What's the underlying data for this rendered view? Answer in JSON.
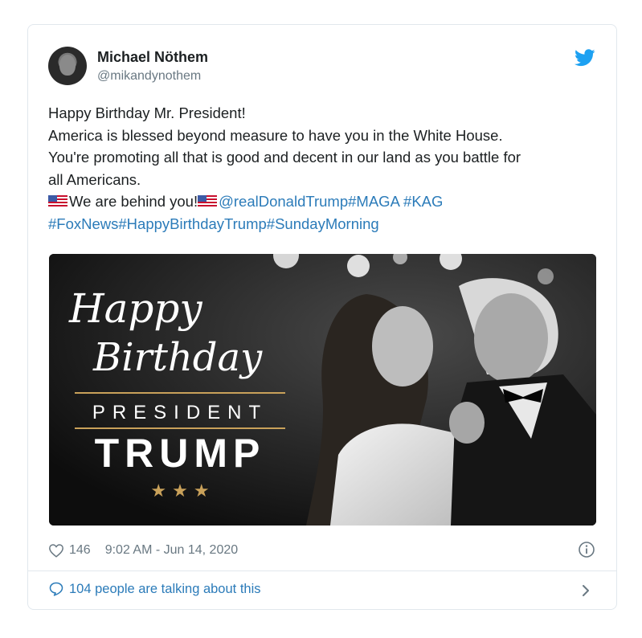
{
  "author": {
    "name": "Michael Nöthem",
    "handle": "@mikandynothem"
  },
  "tweet": {
    "line1": "Happy Birthday Mr. President!",
    "line2": "America is blessed beyond measure to have you in the White House.",
    "line3": "You're promoting all that is good and decent in our land as you battle for",
    "line4": "all Americans.",
    "line5_text": "We are behind you!",
    "mention": "@realDonaldTrump",
    "hashtag1": "#MAGA",
    "hashtag2": "#KAG",
    "hashtag3": "#FoxNews",
    "hashtag4": "#HappyBirthdayTrump",
    "hashtag5": "#SundayMorning"
  },
  "media": {
    "happy": "Happy",
    "birthday": "Birthday",
    "president": "PRESIDENT",
    "trump": "TRUMP",
    "stars": "★ ★ ★"
  },
  "meta": {
    "likes": "146",
    "timestamp": "9:02 AM - Jun 14, 2020"
  },
  "footer": {
    "talking": "104 people are talking about this"
  },
  "colors": {
    "link": "#2b7bb9",
    "muted": "#697882",
    "gold": "#c9a15a",
    "twitter_blue": "#1da1f2"
  },
  "icons": [
    "twitter-bird-icon",
    "heart-icon",
    "info-icon",
    "speech-bubble-icon",
    "chevron-right-icon",
    "us-flag-icon"
  ]
}
